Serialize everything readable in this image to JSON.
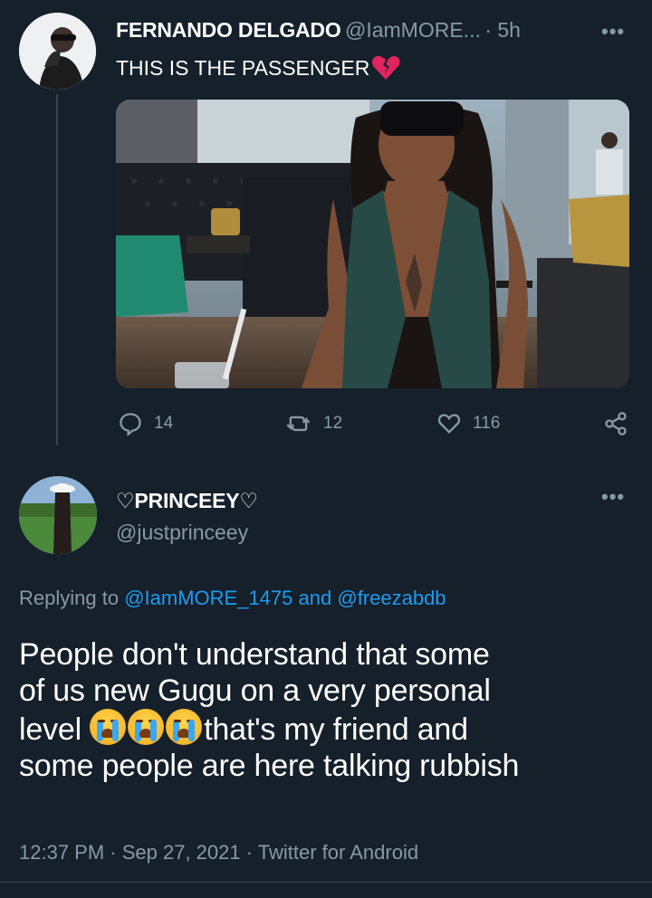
{
  "tweet1": {
    "display_name": "FERNANDO DELGADO",
    "handle": "@IamMORE...",
    "time": "· 5h",
    "text": "THIS IS THE PASSENGER",
    "more": "•••",
    "image_alt": "Photo of a woman in sunglasses and a green halter top seated in a lounge",
    "replies": "14",
    "retweets": "12",
    "likes": "116"
  },
  "tweet2": {
    "display_name": "♡PRINCEEY♡",
    "handle": "@justprinceey",
    "more": "•••",
    "replying_prefix": "Replying to",
    "reply_user_1": "@IamMORE_1475",
    "reply_and": "and",
    "reply_user_2": "@freezabdb",
    "text_line1": "People don't understand that some",
    "text_line2": "of us new Gugu on a very personal",
    "text_line3_a": "level",
    "text_line3_b": "that's my friend and",
    "text_line4": "some people are here talking rubbish",
    "emoji_name": "loudly-crying-face",
    "timestamp": "12:37 PM · Sep 27, 2021 · Twitter for Android"
  },
  "colors": {
    "background": "#15202b",
    "secondary_text": "#8899a6",
    "link": "#1d9bf0",
    "broken_heart": "#e0245e"
  }
}
